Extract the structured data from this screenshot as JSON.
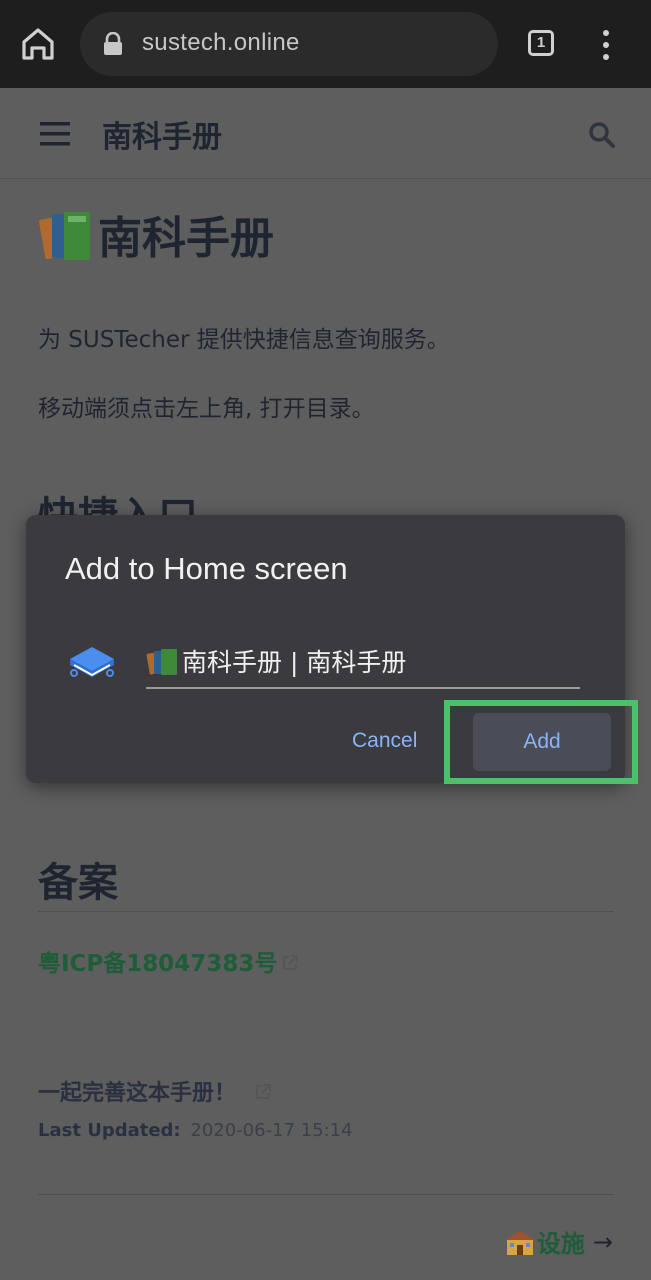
{
  "browser": {
    "url": "sustech.online",
    "tab_count": "1",
    "icons": [
      "home-icon",
      "lock-icon",
      "tabs-icon",
      "more-vert-icon"
    ]
  },
  "page": {
    "header_title": "南科手册",
    "h1_title": "南科手册",
    "para1": "为 SUSTecher 提供快捷信息查询服务。",
    "para2": "移动端须点击左上角, 打开目录。",
    "section_quick": "快捷入口",
    "section_beian": "备案",
    "icp_link": "粤ICP备18047383号",
    "improve_link": "一起完善这本手册！",
    "last_updated_label": "Last Updated:",
    "last_updated_value": "2020-06-17 15:14",
    "next_link": "设施",
    "next_arrow": "→"
  },
  "dialog": {
    "title": "Add to Home screen",
    "name_value": "南科手册 | 南科手册",
    "cancel_label": "Cancel",
    "add_label": "Add"
  },
  "colors": {
    "accent_button_text": "#8ab4f8",
    "highlight": "#4cc06b",
    "link_green": "#1f5c3a",
    "dialog_bg": "#3b3a3e"
  }
}
